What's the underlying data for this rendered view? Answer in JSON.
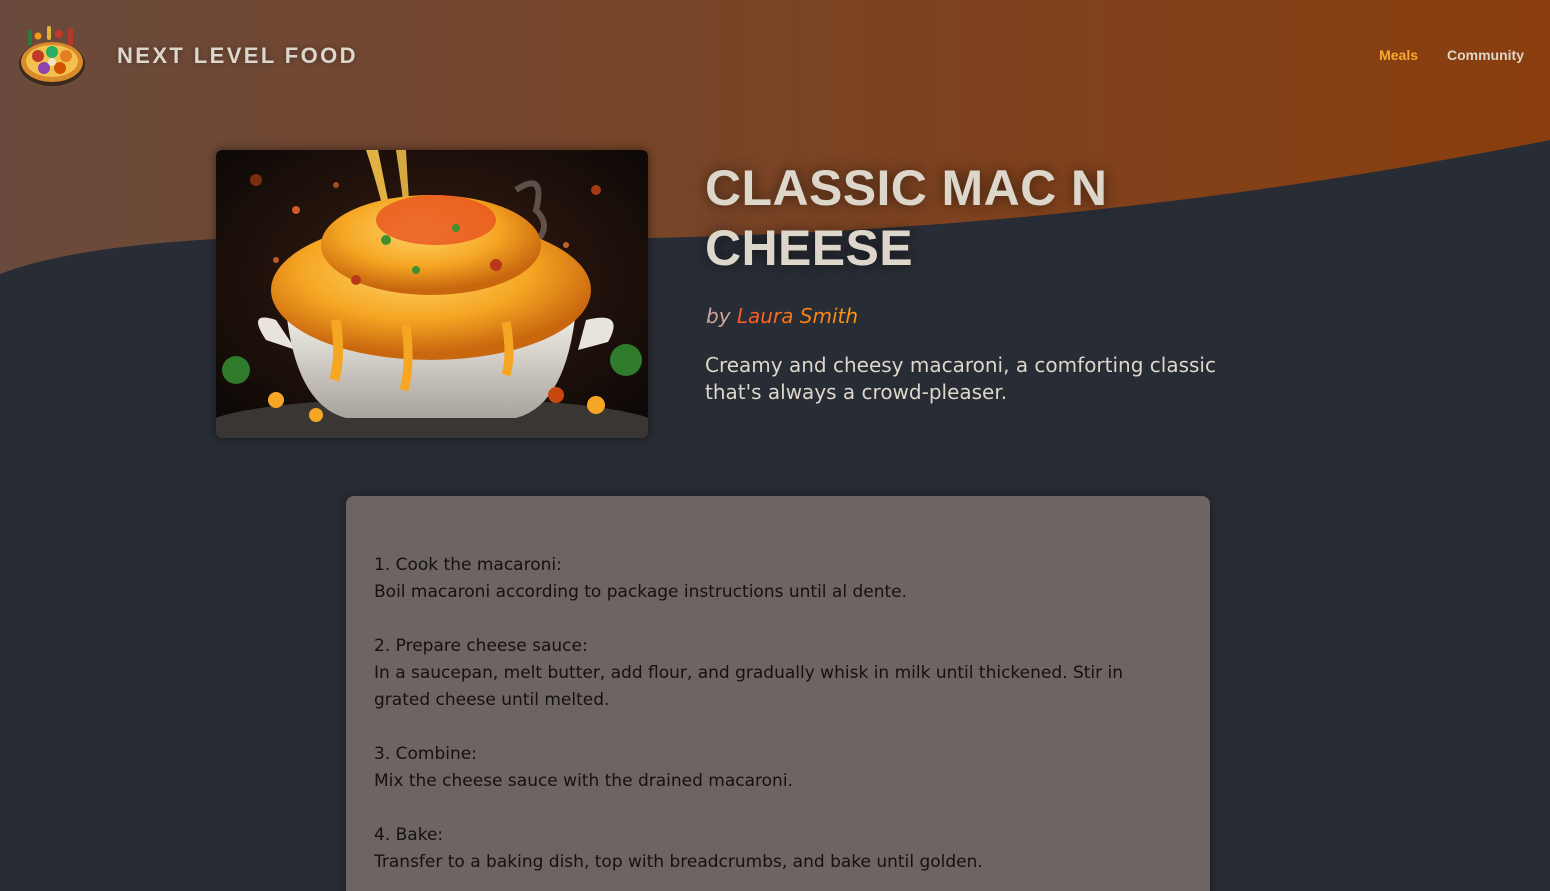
{
  "header": {
    "logo_alt_icon": "food-plate-logo",
    "brand": "NEXT LEVEL FOOD",
    "nav": [
      {
        "label": "Meals",
        "active": true
      },
      {
        "label": "Community",
        "active": false
      }
    ]
  },
  "colors": {
    "header_gradient_start": "#6a4a3c",
    "header_gradient_end": "#8a3e0e",
    "page_background": "#282c34",
    "accent_active_link": "#f8a92e",
    "author_gradient_start": "#f9572a",
    "author_gradient_end": "#ff9b05",
    "instructions_background": "#6e6464"
  },
  "meal": {
    "image_icon": "mac-and-cheese-photo",
    "title": "CLASSIC MAC N CHEESE",
    "by_label": "by",
    "creator": "Laura Smith",
    "summary": "Creamy and cheesy macaroni, a comforting classic that's always a crowd-pleaser."
  },
  "instructions": {
    "steps": [
      {
        "title": "1. Cook the macaroni:",
        "body": "Boil macaroni according to package instructions until al dente."
      },
      {
        "title": "2. Prepare cheese sauce:",
        "body": "In a saucepan, melt butter, add flour, and gradually whisk in milk until thickened. Stir in grated cheese until melted."
      },
      {
        "title": "3. Combine:",
        "body": "Mix the cheese sauce with the drained macaroni."
      },
      {
        "title": "4. Bake:",
        "body": "Transfer to a baking dish, top with breadcrumbs, and bake until golden."
      }
    ]
  }
}
